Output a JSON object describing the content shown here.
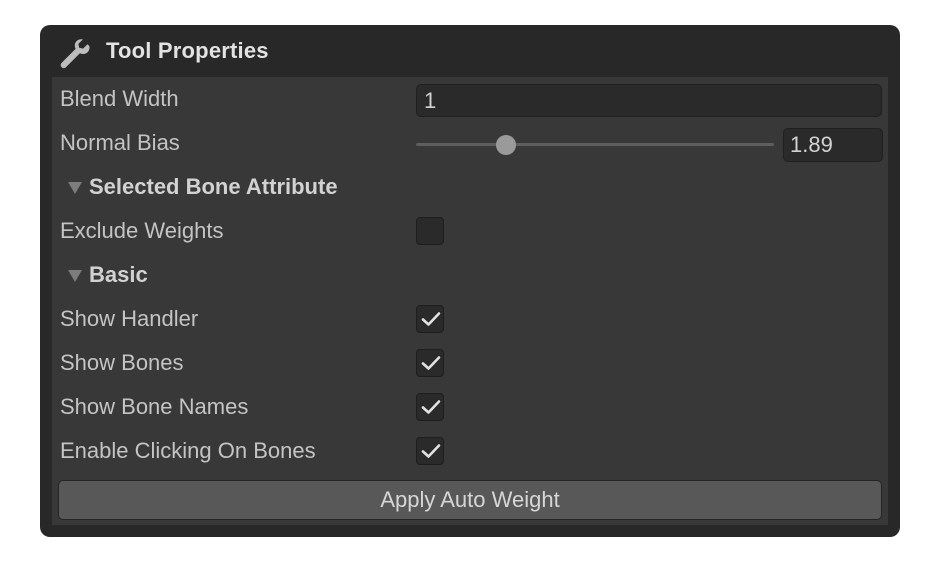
{
  "window": {
    "title": "Tool Properties",
    "icon": "wrench-icon"
  },
  "fields": {
    "blend_width": {
      "label": "Blend Width",
      "value": "1"
    },
    "normal_bias": {
      "label": "Normal Bias",
      "value": "1.89",
      "slider_fraction": 0.23
    }
  },
  "sections": {
    "selected_bone_attribute": {
      "title": "Selected Bone Attribute",
      "expanded": true,
      "exclude_weights": {
        "label": "Exclude Weights",
        "checked": false
      }
    },
    "basic": {
      "title": "Basic",
      "expanded": true,
      "show_handler": {
        "label": "Show Handler",
        "checked": true
      },
      "show_bones": {
        "label": "Show Bones",
        "checked": true
      },
      "show_bone_names": {
        "label": "Show Bone Names",
        "checked": true
      },
      "enable_clicking_on_bones": {
        "label": "Enable Clicking On Bones",
        "checked": true
      }
    }
  },
  "actions": {
    "apply_auto_weight": "Apply Auto Weight"
  },
  "colors": {
    "panel_header": "#282828",
    "panel_body": "#383838",
    "field_bg": "#2a2a2a",
    "button_bg": "#585858",
    "text": "#c4c4c4"
  }
}
